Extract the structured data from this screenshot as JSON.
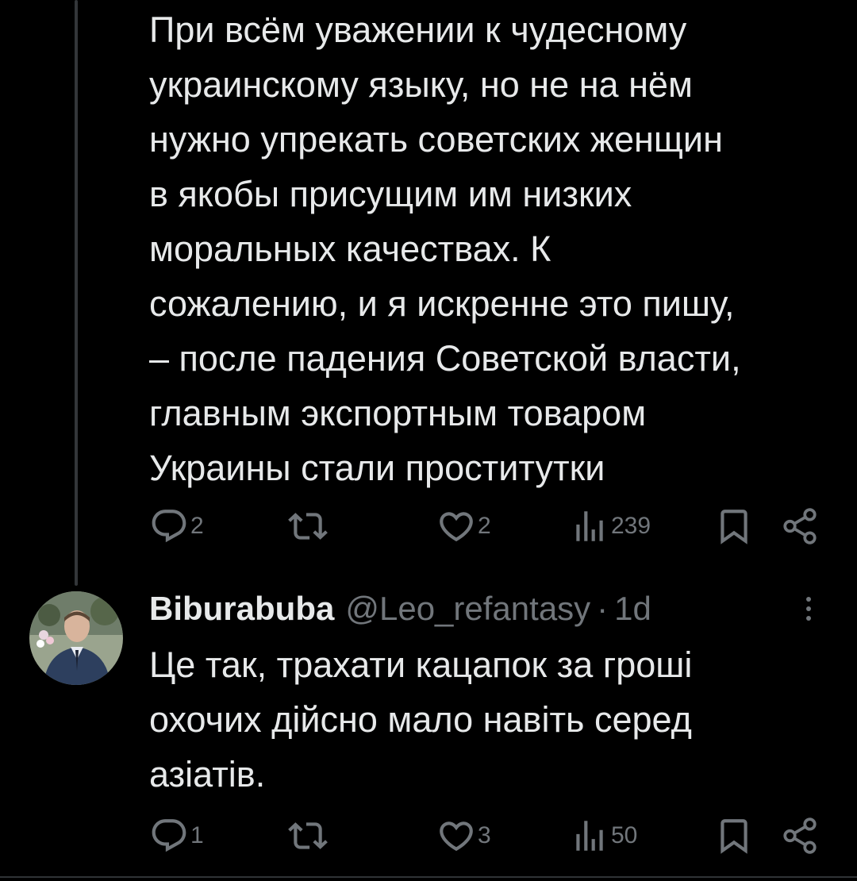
{
  "tweet1": {
    "text": "При всём уважении к чудесному\nукраинскому языку, но не на нём\nнужно упрекать советских женщин\nв якобы присущим им низких\nморальных качествах. К\nсожалению, и я искренне это пишу,\n– после падения Советской власти,\nглавным экспортным товаром\nУкраины стали проститутки",
    "replies": "2",
    "retweets": "",
    "likes": "2",
    "views": "239"
  },
  "tweet2": {
    "display_name": "Biburabuba",
    "handle": "@Leo_refantasy",
    "separator": "·",
    "time": "1d",
    "text": "Це так, трахати кацапок за гроші\nохочих дійсно мало навіть серед\nазіатів.",
    "replies": "1",
    "retweets": "",
    "likes": "3",
    "views": "50"
  },
  "icons": {
    "reply": "reply-icon",
    "retweet": "retweet-icon",
    "like": "heart-icon",
    "views": "views-icon",
    "bookmark": "bookmark-icon",
    "share": "share-icon",
    "more": "more-options-icon"
  },
  "colors": {
    "background": "#000000",
    "text": "#e7e9ea",
    "secondary": "#71767b",
    "thread_line": "#333639"
  }
}
